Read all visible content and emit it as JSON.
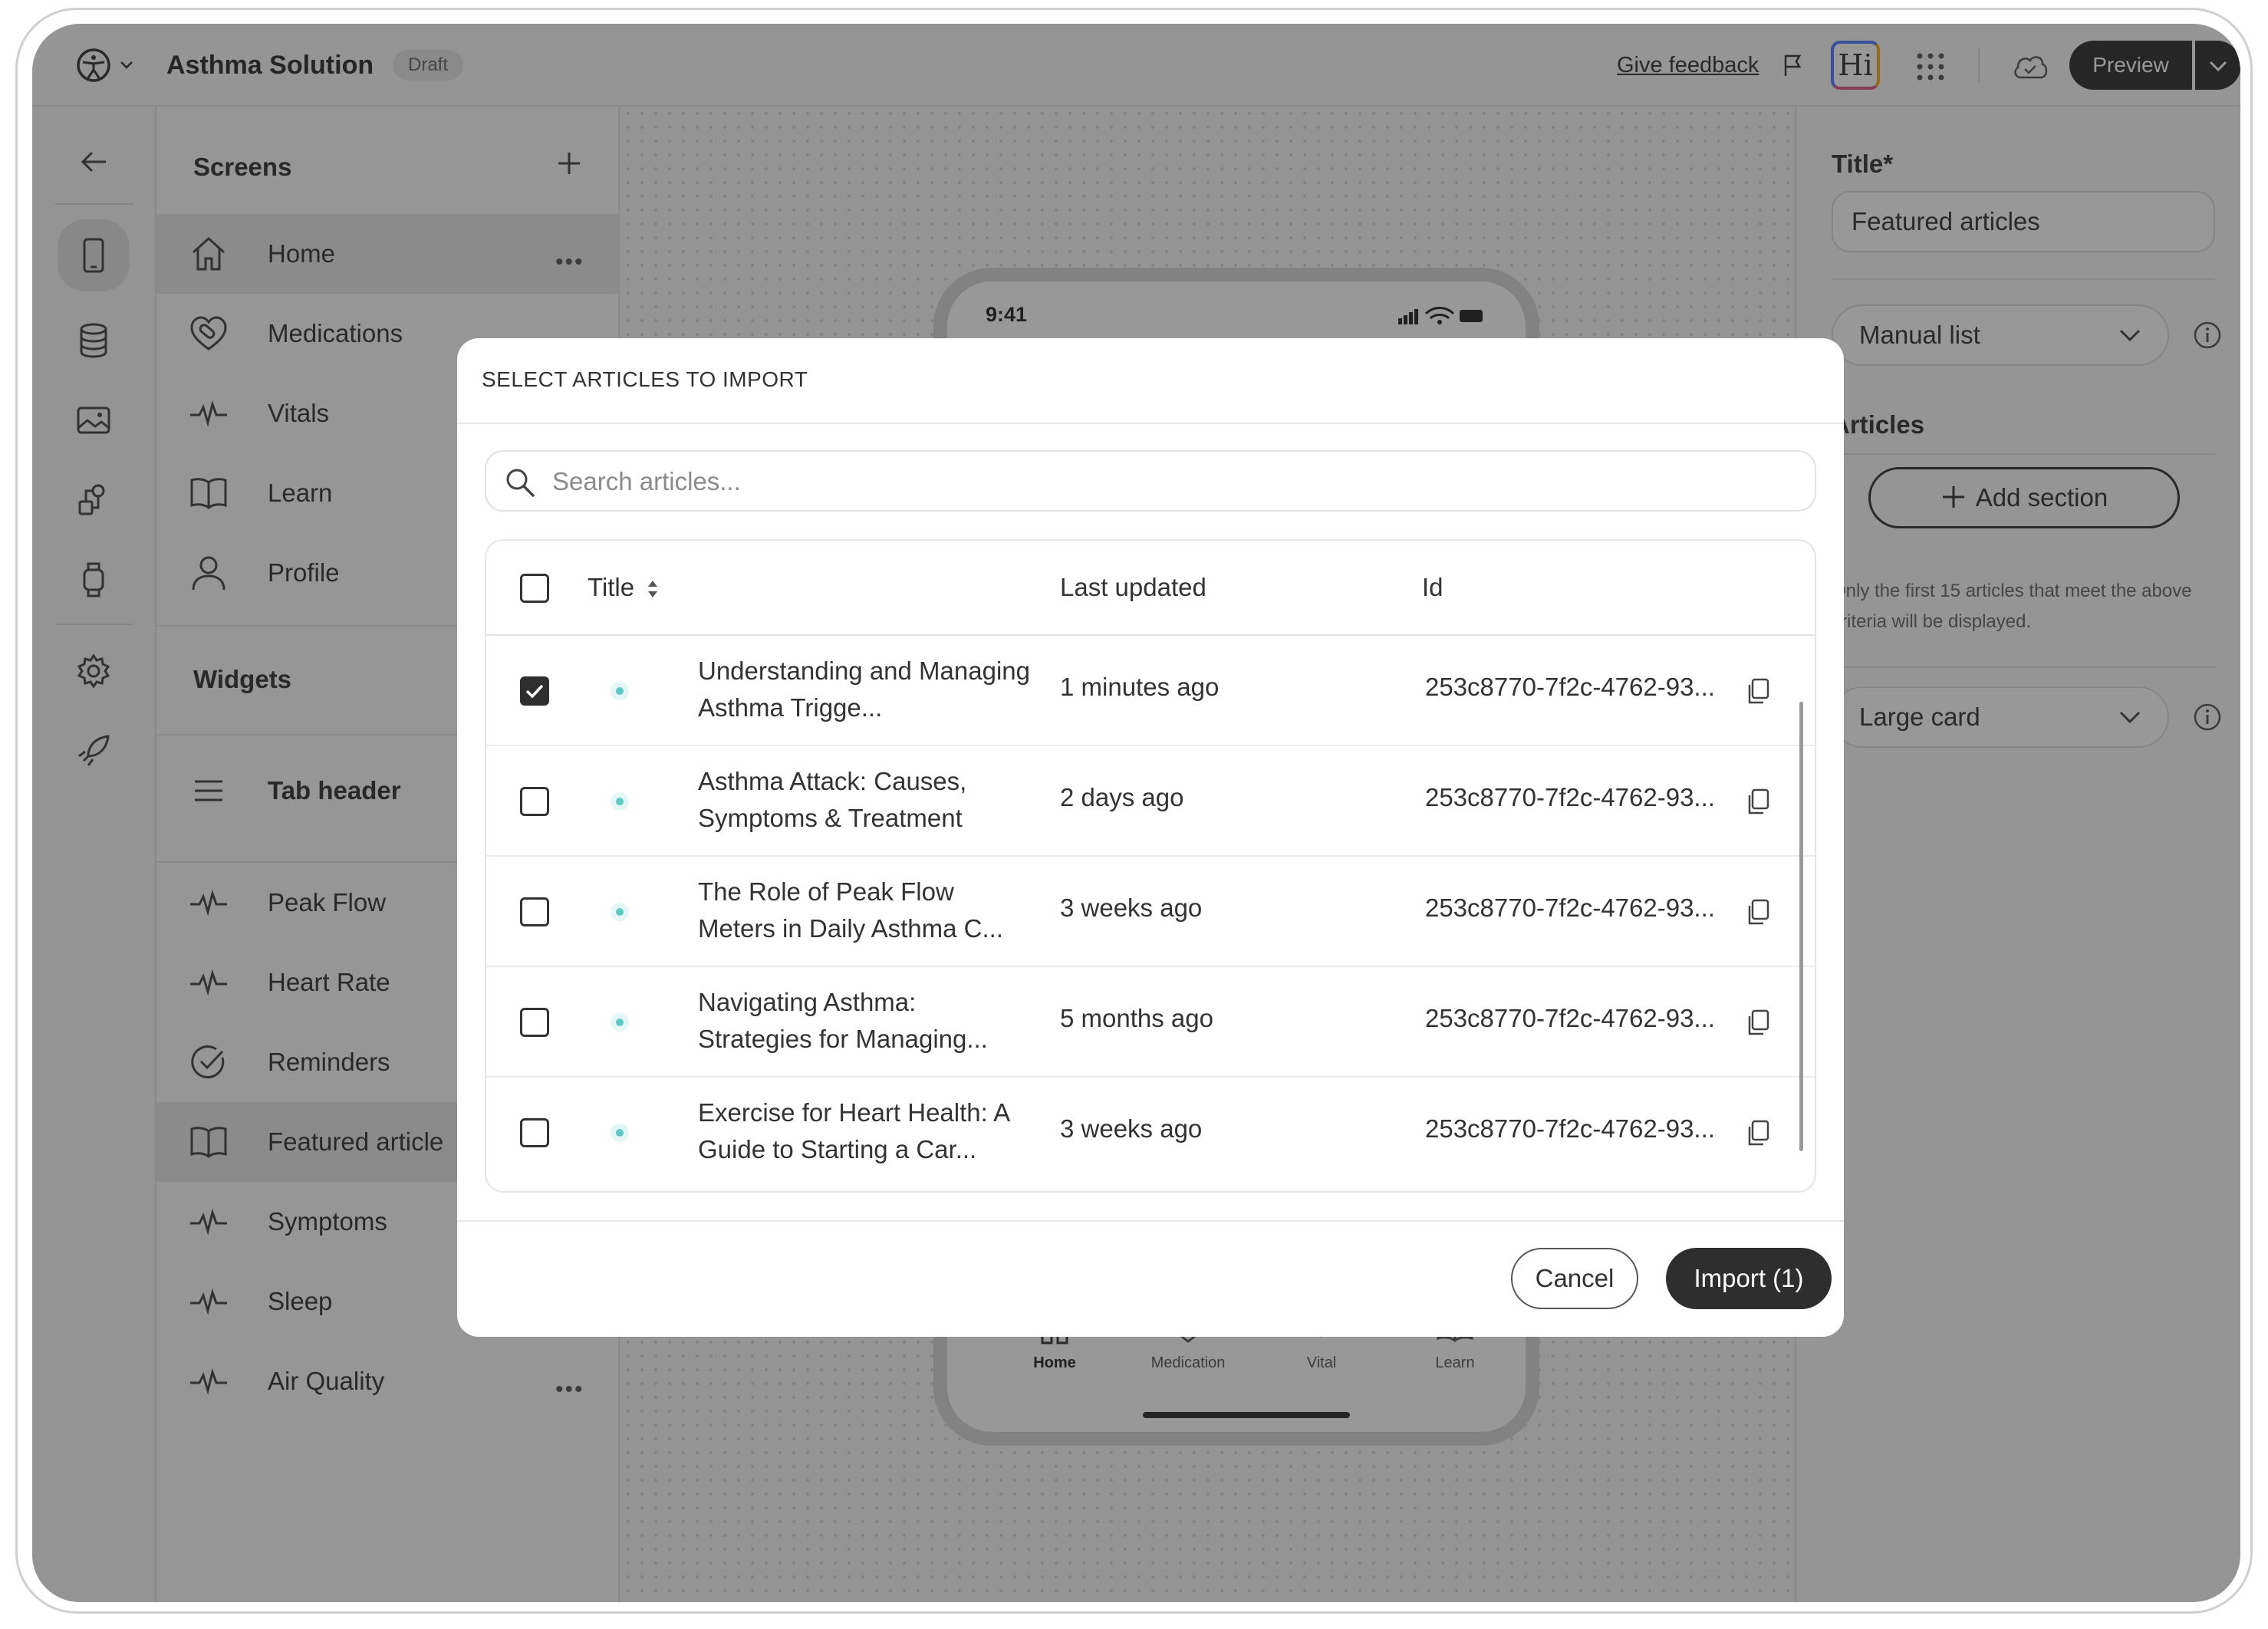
{
  "app": {
    "title": "Asthma Solution",
    "status_badge": "Draft",
    "feedback_link": "Give feedback",
    "ai_badge": "Hi",
    "preview_label": "Preview"
  },
  "sidebar": {
    "screens_title": "Screens",
    "screens": [
      {
        "label": "Home",
        "icon": "home-icon"
      },
      {
        "label": "Medications",
        "icon": "medication-icon"
      },
      {
        "label": "Vitals",
        "icon": "pulse-icon"
      },
      {
        "label": "Learn",
        "icon": "book-icon"
      },
      {
        "label": "Profile",
        "icon": "user-icon"
      }
    ],
    "widgets_title": "Widgets",
    "tab_header": "Tab header",
    "widgets": [
      {
        "label": "Peak Flow",
        "icon": "pulse-icon"
      },
      {
        "label": "Heart Rate",
        "icon": "pulse-icon"
      },
      {
        "label": "Reminders",
        "icon": "check-circle-icon"
      },
      {
        "label": "Featured article",
        "icon": "book-icon"
      },
      {
        "label": "Symptoms",
        "icon": "pulse-icon"
      },
      {
        "label": "Sleep",
        "icon": "pulse-icon"
      },
      {
        "label": "Air Quality",
        "icon": "pulse-icon"
      }
    ]
  },
  "phone": {
    "time": "9:41",
    "tabs": [
      "Home",
      "Medication",
      "Vital",
      "Learn"
    ]
  },
  "properties": {
    "title_label": "Title*",
    "title_value": "Featured articles",
    "list_type": "Manual list",
    "articles_label": "Articles",
    "add_section": "Add section",
    "note": "Only the first 15 articles that meet the above criteria will be displayed.",
    "card_style": "Large card"
  },
  "modal": {
    "heading": "SELECT ARTICLES TO IMPORT",
    "search_placeholder": "Search articles...",
    "columns": {
      "title": "Title",
      "updated": "Last updated",
      "id": "Id"
    },
    "rows": [
      {
        "checked": true,
        "title": "Understanding and Managing Asthma Trigge...",
        "updated": "1 minutes ago",
        "id": "253c8770-7f2c-4762-93..."
      },
      {
        "checked": false,
        "title": "Asthma Attack: Causes, Symptoms & Treatment",
        "updated": "2 days ago",
        "id": "253c8770-7f2c-4762-93..."
      },
      {
        "checked": false,
        "title": "The Role of Peak Flow Meters in Daily Asthma C...",
        "updated": "3 weeks ago",
        "id": "253c8770-7f2c-4762-93..."
      },
      {
        "checked": false,
        "title": "Navigating Asthma: Strategies for Managing...",
        "updated": "5 months ago",
        "id": "253c8770-7f2c-4762-93..."
      },
      {
        "checked": false,
        "title": "Exercise for Heart Health: A Guide to Starting a Car...",
        "updated": "3 weeks ago",
        "id": "253c8770-7f2c-4762-93..."
      }
    ],
    "cancel": "Cancel",
    "import": "Import (1)"
  },
  "colors": {
    "primary_dark": "#2e2e2e",
    "overlay": "rgba(30,30,30,0.46)",
    "status_dot": "#5ec9c2"
  }
}
